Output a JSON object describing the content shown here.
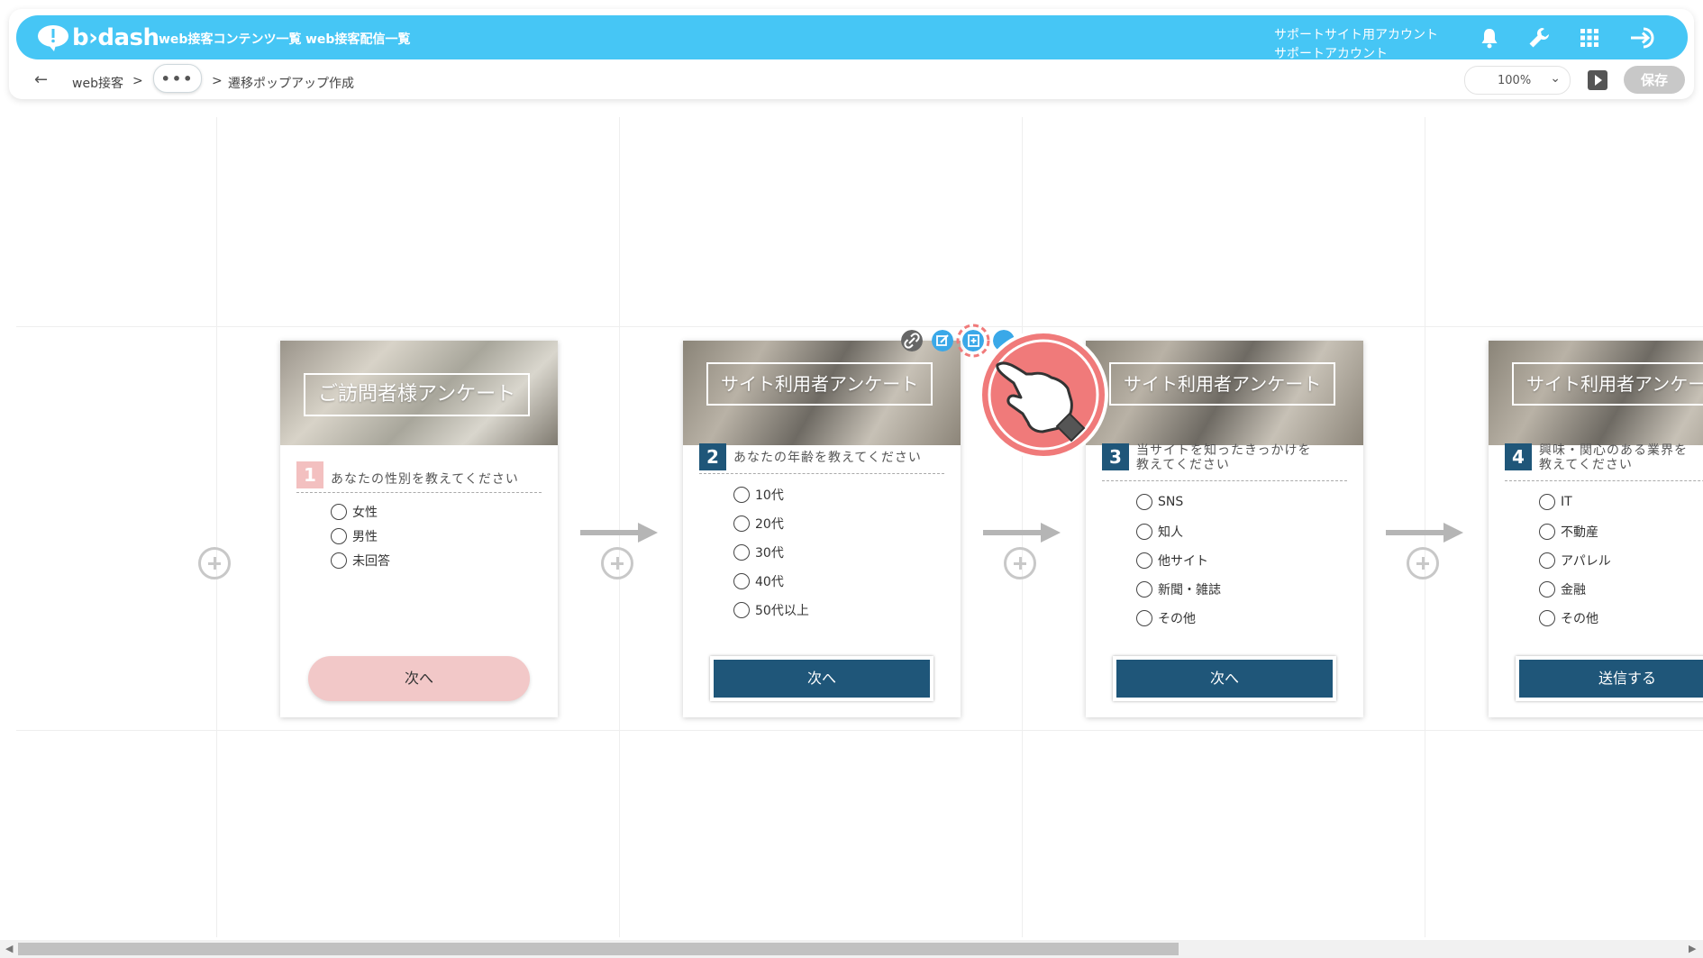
{
  "header": {
    "logo_text": "b›dash",
    "nav": [
      "web接客コンテンツ一覧",
      "web接客配信一覧"
    ],
    "account_line1": "サポートサイト用アカウント",
    "account_line2": "サポートアカウント",
    "icons": [
      "bell-icon",
      "wrench-icon",
      "grid-icon",
      "logout-icon"
    ],
    "accent_color": "#46c6f5"
  },
  "subbar": {
    "back": "←",
    "crumb1": "web接客",
    "sep": ">",
    "dots": "•••",
    "crumb2": "遷移ポップアップ作成",
    "zoom": "100%",
    "save": "保存"
  },
  "cards": [
    {
      "img_title": "ご訪問者様アンケート",
      "number": "1",
      "number_color": "#f3c0c0",
      "question": "あなたの性別を教えてください",
      "options": [
        "女性",
        "男性",
        "未回答"
      ],
      "button": "次へ"
    },
    {
      "img_title": "サイト利用者アンケート",
      "number": "2",
      "number_color": "#1f5679",
      "question": "あなたの年齢を教えてください",
      "options": [
        "10代",
        "20代",
        "30代",
        "40代",
        "50代以上"
      ],
      "button": "次へ"
    },
    {
      "img_title": "サイト利用者アンケート",
      "number": "3",
      "number_color": "#1f5679",
      "question_l1": "当サイトを知ったきっかけを",
      "question_l2": "教えてください",
      "options": [
        "SNS",
        "知人",
        "他サイト",
        "新聞・雑誌",
        "その他"
      ],
      "button": "次へ"
    },
    {
      "img_title": "サイト利用者アンケート",
      "number": "4",
      "number_color": "#1f5679",
      "question_l1": "興味・関心のある業界を",
      "question_l2": "教えてください",
      "options": [
        "IT",
        "不動産",
        "アパレル",
        "金融",
        "その他"
      ],
      "button": "送信する"
    }
  ],
  "toolbar_icons": [
    "link-icon",
    "edit-icon",
    "copy-icon"
  ],
  "colors": {
    "navy": "#1f5679",
    "pink": "#f2c8c8",
    "pointer": "#f07a7a"
  }
}
